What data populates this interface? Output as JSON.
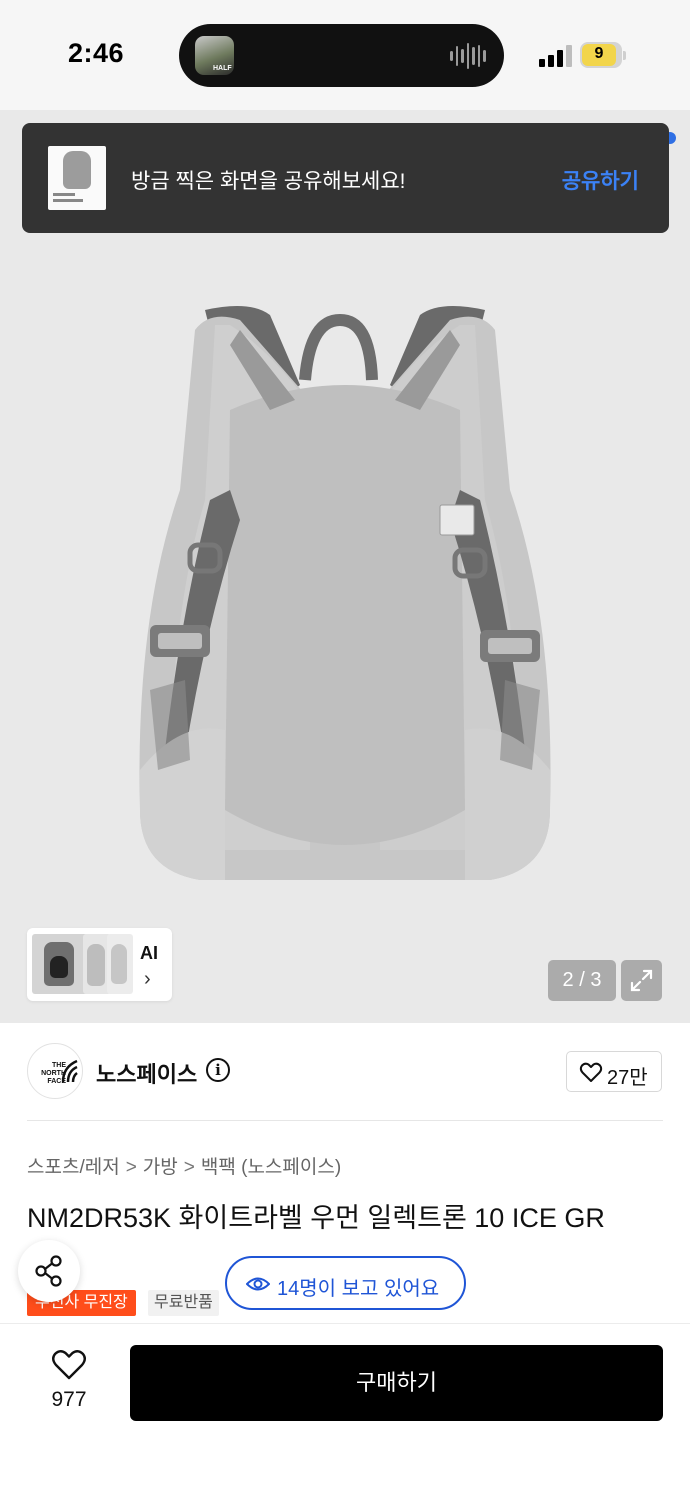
{
  "status_bar": {
    "time": "2:46",
    "island_thumb_text": "HALF",
    "battery": "9"
  },
  "toast": {
    "message": "방금 찍은 화면을 공유해보세요!",
    "action": "공유하기"
  },
  "gallery": {
    "ai_label": "AI",
    "chevron": "›",
    "counter": "2 / 3"
  },
  "brand": {
    "logo_text": "THE NORTH FACE",
    "name": "노스페이스",
    "like_count": "27만"
  },
  "breadcrumb": [
    "스포츠/레저",
    "가방",
    "백팩 (노스페이스)"
  ],
  "breadcrumb_separator": ">",
  "product": {
    "title": "NM2DR53K 화이트라벨 우먼 일렉트론 10 ICE GR",
    "badges": [
      "무신사 무진장",
      "무료반품"
    ],
    "viewers": "14명이 보고 있어요"
  },
  "bottom_bar": {
    "wish_count": "977",
    "buy_label": "구매하기"
  },
  "colors": {
    "accent_blue": "#1f55d6",
    "toast_action": "#3b82f6",
    "badge_orange": "#ff4d1a",
    "buy_button": "#000000"
  }
}
